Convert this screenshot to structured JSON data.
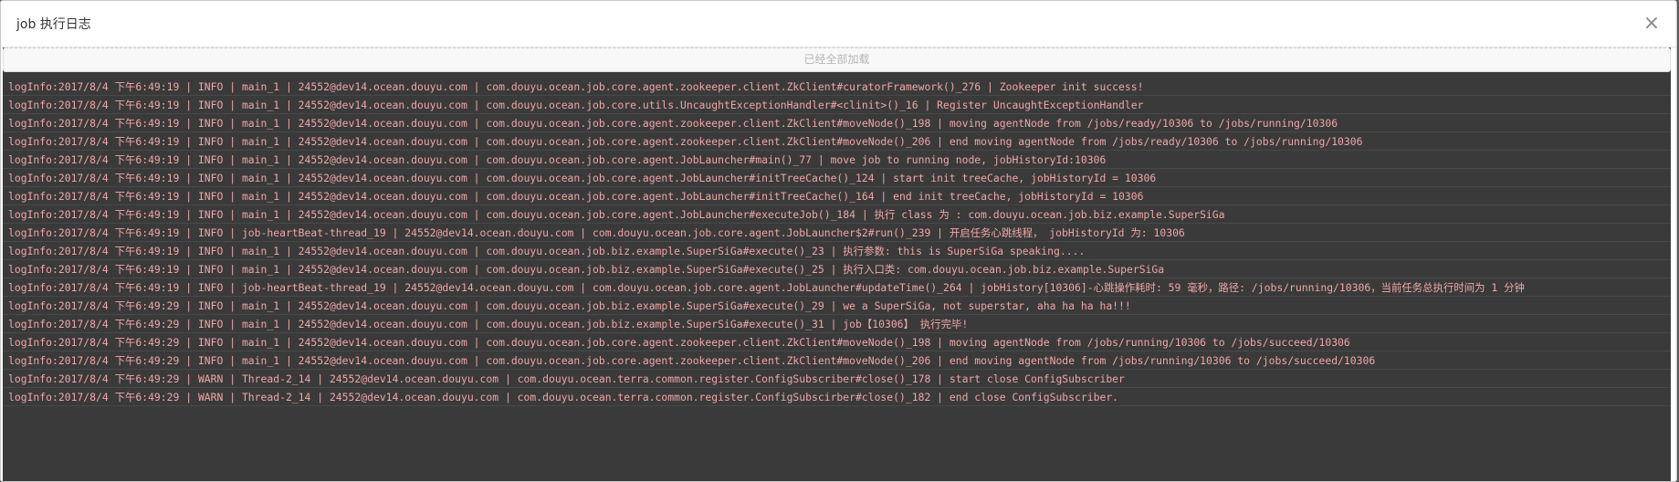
{
  "dialog": {
    "title": "job 执行日志",
    "close_symbol": "×",
    "load_status": "已经全部加载"
  },
  "log_lines": [
    "logInfo:2017/8/4 下午6:49:19 | INFO | main_1 | 24552@dev14.ocean.douyu.com | com.douyu.ocean.job.core.agent.zookeeper.client.ZkClient#curatorFramework()_276 | Zookeeper init success!",
    "logInfo:2017/8/4 下午6:49:19 | INFO | main_1 | 24552@dev14.ocean.douyu.com | com.douyu.ocean.job.core.utils.UncaughtExceptionHandler#<clinit>()_16 | Register UncaughtExceptionHandler",
    "logInfo:2017/8/4 下午6:49:19 | INFO | main_1 | 24552@dev14.ocean.douyu.com | com.douyu.ocean.job.core.agent.zookeeper.client.ZkClient#moveNode()_198 | moving agentNode from /jobs/ready/10306 to /jobs/running/10306",
    "logInfo:2017/8/4 下午6:49:19 | INFO | main_1 | 24552@dev14.ocean.douyu.com | com.douyu.ocean.job.core.agent.zookeeper.client.ZkClient#moveNode()_206 | end moving agentNode from /jobs/ready/10306 to /jobs/running/10306",
    "logInfo:2017/8/4 下午6:49:19 | INFO | main_1 | 24552@dev14.ocean.douyu.com | com.douyu.ocean.job.core.agent.JobLauncher#main()_77 | move job to running node, jobHistoryId:10306",
    "logInfo:2017/8/4 下午6:49:19 | INFO | main_1 | 24552@dev14.ocean.douyu.com | com.douyu.ocean.job.core.agent.JobLauncher#initTreeCache()_124 | start init treeCache, jobHistoryId = 10306",
    "logInfo:2017/8/4 下午6:49:19 | INFO | main_1 | 24552@dev14.ocean.douyu.com | com.douyu.ocean.job.core.agent.JobLauncher#initTreeCache()_164 | end init treeCache, jobHistoryId = 10306",
    "logInfo:2017/8/4 下午6:49:19 | INFO | main_1 | 24552@dev14.ocean.douyu.com | com.douyu.ocean.job.core.agent.JobLauncher#executeJob()_184 | 执行 class 为 : com.douyu.ocean.job.biz.example.SuperSiGa",
    "logInfo:2017/8/4 下午6:49:19 | INFO | job-heartBeat-thread_19 | 24552@dev14.ocean.douyu.com | com.douyu.ocean.job.core.agent.JobLauncher$2#run()_239 | 开启任务心跳线程， jobHistoryId 为: 10306",
    "logInfo:2017/8/4 下午6:49:19 | INFO | main_1 | 24552@dev14.ocean.douyu.com | com.douyu.ocean.job.biz.example.SuperSiGa#execute()_23 | 执行参数: this is SuperSiGa speaking....",
    "logInfo:2017/8/4 下午6:49:19 | INFO | main_1 | 24552@dev14.ocean.douyu.com | com.douyu.ocean.job.biz.example.SuperSiGa#execute()_25 | 执行入口类: com.douyu.ocean.job.biz.example.SuperSiGa",
    "logInfo:2017/8/4 下午6:49:19 | INFO | job-heartBeat-thread_19 | 24552@dev14.ocean.douyu.com | com.douyu.ocean.job.core.agent.JobLauncher#updateTime()_264 | jobHistory[10306]-心跳操作耗时: 59 毫秒，路径: /jobs/running/10306，当前任务总执行时间为 1 分钟",
    "logInfo:2017/8/4 下午6:49:29 | INFO | main_1 | 24552@dev14.ocean.douyu.com | com.douyu.ocean.job.biz.example.SuperSiGa#execute()_29 | we a SuperSiGa, not superstar, aha ha ha ha!!!",
    "logInfo:2017/8/4 下午6:49:29 | INFO | main_1 | 24552@dev14.ocean.douyu.com | com.douyu.ocean.job.biz.example.SuperSiGa#execute()_31 | job【10306】 执行完毕!",
    "logInfo:2017/8/4 下午6:49:29 | INFO | main_1 | 24552@dev14.ocean.douyu.com | com.douyu.ocean.job.core.agent.zookeeper.client.ZkClient#moveNode()_198 | moving agentNode from /jobs/running/10306 to /jobs/succeed/10306",
    "logInfo:2017/8/4 下午6:49:29 | INFO | main_1 | 24552@dev14.ocean.douyu.com | com.douyu.ocean.job.core.agent.zookeeper.client.ZkClient#moveNode()_206 | end moving agentNode from /jobs/running/10306 to /jobs/succeed/10306",
    "logInfo:2017/8/4 下午6:49:29 | WARN | Thread-2_14 | 24552@dev14.ocean.douyu.com | com.douyu.ocean.terra.common.register.ConfigSubscriber#close()_178 | start close ConfigSubscriber",
    "logInfo:2017/8/4 下午6:49:29 | WARN | Thread-2_14 | 24552@dev14.ocean.douyu.com | com.douyu.ocean.terra.common.register.ConfigSubscirber#close()_182 | end close ConfigSubscriber."
  ],
  "colors": {
    "log_text": "#f0a6a6",
    "log_background": "#3a3a3a",
    "header_background": "#ffffff"
  },
  "icons": {
    "close": "close-icon"
  }
}
